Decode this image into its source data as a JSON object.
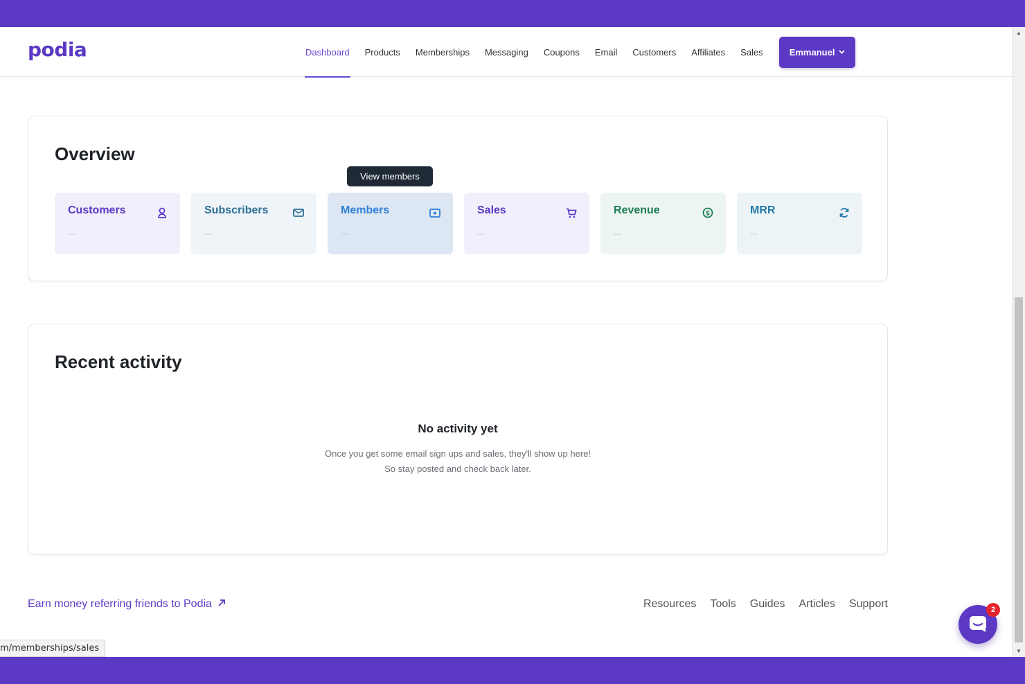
{
  "brand": {
    "logo_text": "podia",
    "color": "#5b39c4"
  },
  "nav": {
    "items": [
      {
        "label": "Dashboard",
        "active": true
      },
      {
        "label": "Products"
      },
      {
        "label": "Memberships"
      },
      {
        "label": "Messaging"
      },
      {
        "label": "Coupons"
      },
      {
        "label": "Email"
      },
      {
        "label": "Customers"
      },
      {
        "label": "Affiliates"
      },
      {
        "label": "Sales"
      }
    ],
    "user_label": "Emmanuel"
  },
  "overview": {
    "title": "Overview",
    "tooltip": "View members",
    "tiles": [
      {
        "label": "Customers",
        "value": "—",
        "icon": "user-icon"
      },
      {
        "label": "Subscribers",
        "value": "—",
        "icon": "envelope-icon"
      },
      {
        "label": "Members",
        "value": "—",
        "icon": "member-card-icon"
      },
      {
        "label": "Sales",
        "value": "—",
        "icon": "cart-icon"
      },
      {
        "label": "Revenue",
        "value": "—",
        "icon": "dollar-icon"
      },
      {
        "label": "MRR",
        "value": "—",
        "icon": "refresh-icon"
      }
    ]
  },
  "activity": {
    "title": "Recent activity",
    "empty_title": "No activity yet",
    "empty_desc": "Once you get some email sign ups and sales, they'll show up here! So stay posted and check back later."
  },
  "footer": {
    "referral": "Earn money referring friends to Podia",
    "links": [
      "Resources",
      "Tools",
      "Guides",
      "Articles",
      "Support"
    ]
  },
  "status_url": "m/memberships/sales",
  "chat": {
    "badge_count": "2"
  }
}
